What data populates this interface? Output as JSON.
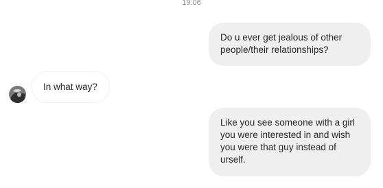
{
  "conversation": {
    "timestamp": "19:06",
    "messages": [
      {
        "direction": "outgoing",
        "text": "Do u ever get jealous of other\npeople/their relationships?"
      },
      {
        "direction": "incoming",
        "text": "In what way?"
      },
      {
        "direction": "outgoing",
        "text": "Like you see someone with a girl\nyou were interested in and wish\nyou were that guy instead of\nurself."
      }
    ]
  },
  "colors": {
    "outgoing_bubble": "#efefef",
    "incoming_bubble_border": "#efefef",
    "text": "#262626",
    "timestamp": "#8e8e8e"
  },
  "icons": {
    "avatar": "contact-avatar"
  }
}
